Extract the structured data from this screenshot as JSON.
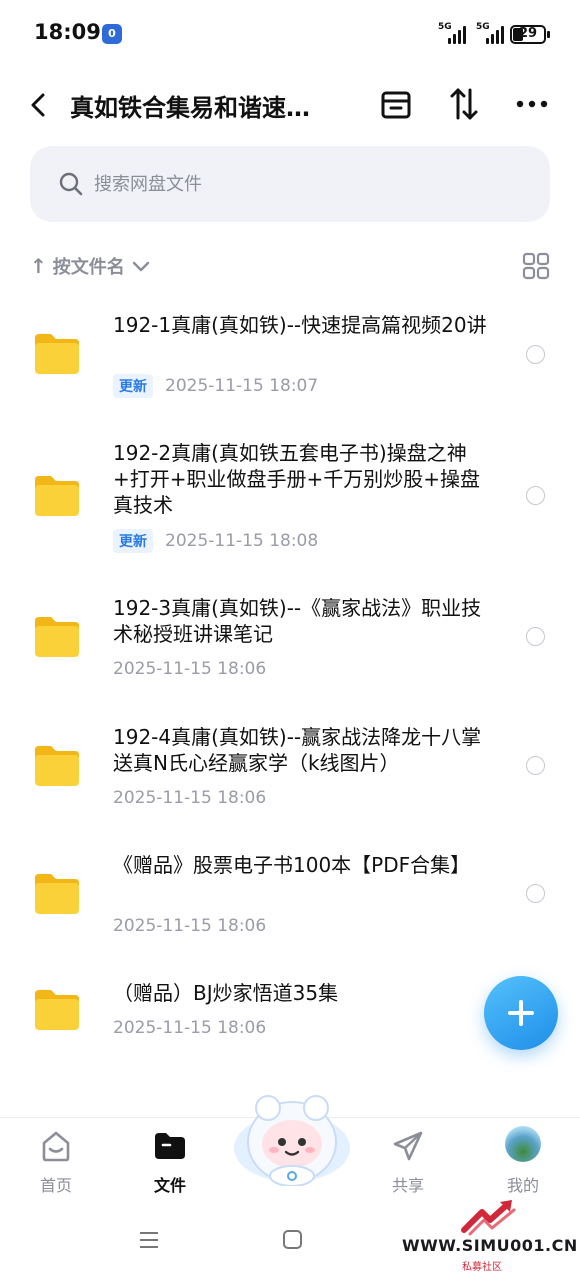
{
  "status_bar": {
    "time": "18:09",
    "app_badge": "0",
    "network_1": "5G",
    "network_2": "5G",
    "battery_level": "29"
  },
  "header": {
    "back_icon": "chevron-left-icon",
    "title": "真如铁合集易和谐速…",
    "archive_icon": "archive-box-icon",
    "sort_icon": "sort-arrows-icon",
    "more_icon": "more-dots-icon"
  },
  "search": {
    "placeholder": "搜索网盘文件",
    "icon": "search-icon"
  },
  "sort_bar": {
    "arrow": "↑",
    "label": "按文件名",
    "chevron": "⌵",
    "view_toggle_icon": "grid-view-icon"
  },
  "files": [
    {
      "name": "192-1真庸(真如铁)--快速提高篇视频20讲",
      "badge": "更新",
      "date": "2025-11-15  18:07"
    },
    {
      "name": "192-2真庸(真如铁五套电子书)操盘之神+打开+职业做盘手册+千万别炒股+操盘真技术",
      "badge": "更新",
      "date": "2025-11-15  18:08"
    },
    {
      "name": "192-3真庸(真如铁)--《赢家战法》职业技术秘授班讲课笔记",
      "badge": "",
      "date": "2025-11-15  18:06"
    },
    {
      "name": "192-4真庸(真如铁)--赢家战法降龙十八掌送真N氏心经赢家学（k线图片）",
      "badge": "",
      "date": "2025-11-15  18:06"
    },
    {
      "name": "《赠品》股票电子书100本【PDF合集】",
      "badge": "",
      "date": "2025-11-15  18:06"
    },
    {
      "name": "（赠品）BJ炒家悟道35集",
      "badge": "",
      "date": "2025-11-15  18:06"
    }
  ],
  "fab": {
    "icon": "plus-icon"
  },
  "bottom_nav": {
    "items": [
      {
        "label": "首页",
        "icon": "home-icon"
      },
      {
        "label": "文件",
        "icon": "folder-icon"
      },
      {
        "label": "共享",
        "icon": "send-icon"
      },
      {
        "label": "我的",
        "icon": "avatar"
      }
    ],
    "active": "文件"
  },
  "watermark": {
    "text": "WWW.SIMU001.CN",
    "sub": "私募社区"
  },
  "colors": {
    "accent": "#2a7be4",
    "folder": "#f7c520",
    "search_bg": "#f1f2f8",
    "secondary_text": "#8b8e99"
  }
}
